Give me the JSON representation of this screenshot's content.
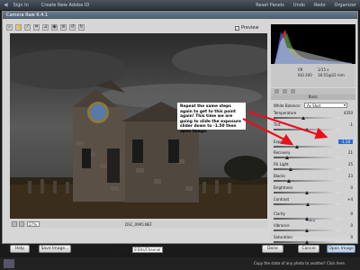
{
  "top_bar": {
    "sign_in": "Sign In",
    "create_id": "Create New Adobe ID",
    "reset_panels": "Reset Panels",
    "undo": "Undo",
    "redo": "Redo",
    "organizer": "Organizer"
  },
  "dialog": {
    "title": "Camera Raw 6.4.1",
    "preview_label": "Preview",
    "preview_checked": true,
    "zoom_value": "27%",
    "filename": "DSC_0995.NEF"
  },
  "exif": {
    "aperture": "f/8",
    "shutter": "1/15 s",
    "iso": "ISO 200",
    "focal": "18-55@22 mm"
  },
  "panel": {
    "section_title": "Basic",
    "white_balance_label": "White Balance:",
    "white_balance_value": "As Shot",
    "auto_label": "Auto",
    "sliders": [
      {
        "name": "Temperature",
        "value": "4350",
        "level": 0.45
      },
      {
        "name": "Tint",
        "value": "-1",
        "level": 0.5
      },
      {
        "name": "Exposure",
        "value": "-1.50",
        "level": 0.35,
        "highlight": true
      },
      {
        "name": "Recovery",
        "value": "21",
        "level": 0.2
      },
      {
        "name": "Fill Light",
        "value": "25",
        "level": 0.25
      },
      {
        "name": "Blacks",
        "value": "23",
        "level": 0.23
      },
      {
        "name": "Brightness",
        "value": "0",
        "level": 0.5
      },
      {
        "name": "Contrast",
        "value": "+4",
        "level": 0.52
      },
      {
        "name": "Clarity",
        "value": "0",
        "level": 0.5
      },
      {
        "name": "Vibrance",
        "value": "0",
        "level": 0.5
      },
      {
        "name": "Saturation",
        "value": "0",
        "level": 0.5
      }
    ]
  },
  "buttons": {
    "help": "Help",
    "save_image": "Save Image...",
    "depth_label": "Depth:",
    "depth_value": "8 Bits/Channel",
    "done": "Done",
    "cancel": "Cancel",
    "open_image": "Open Image"
  },
  "annotation": {
    "text": "Repeat the same steps again to get to this point again! This time we are going to slide the exposure slider down to -1.50 then open image."
  },
  "status_bar": {
    "message": "Copy the state of any photo to another! Click here."
  },
  "colors": {
    "arrow": "#e8101c",
    "highlight": "#2a6bd6"
  }
}
